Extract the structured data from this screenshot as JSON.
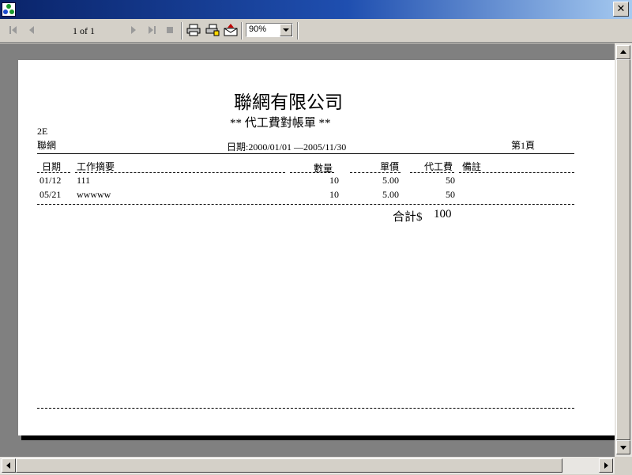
{
  "toolbar": {
    "page_indicator": "1 of 1",
    "zoom_value": "90%"
  },
  "report": {
    "company": "聯網有限公司",
    "report_title": "** 代工費對帳單 **",
    "customer_code": "2E",
    "customer_name": "聯網",
    "date_range": "日期:2000/01/01 —2005/11/30",
    "page_label": "第1頁",
    "columns": {
      "date": "日期",
      "desc": "工作摘要",
      "qty": "數量",
      "price": "單價",
      "fee": "代工費",
      "note": "備註"
    },
    "rows": [
      {
        "date": "01/12",
        "desc": "111",
        "qty": "10",
        "price": "5.00",
        "fee": "50"
      },
      {
        "date": "05/21",
        "desc": "wwwww",
        "qty": "10",
        "price": "5.00",
        "fee": "50"
      }
    ],
    "total_label": "合計$",
    "total_value": "100"
  }
}
